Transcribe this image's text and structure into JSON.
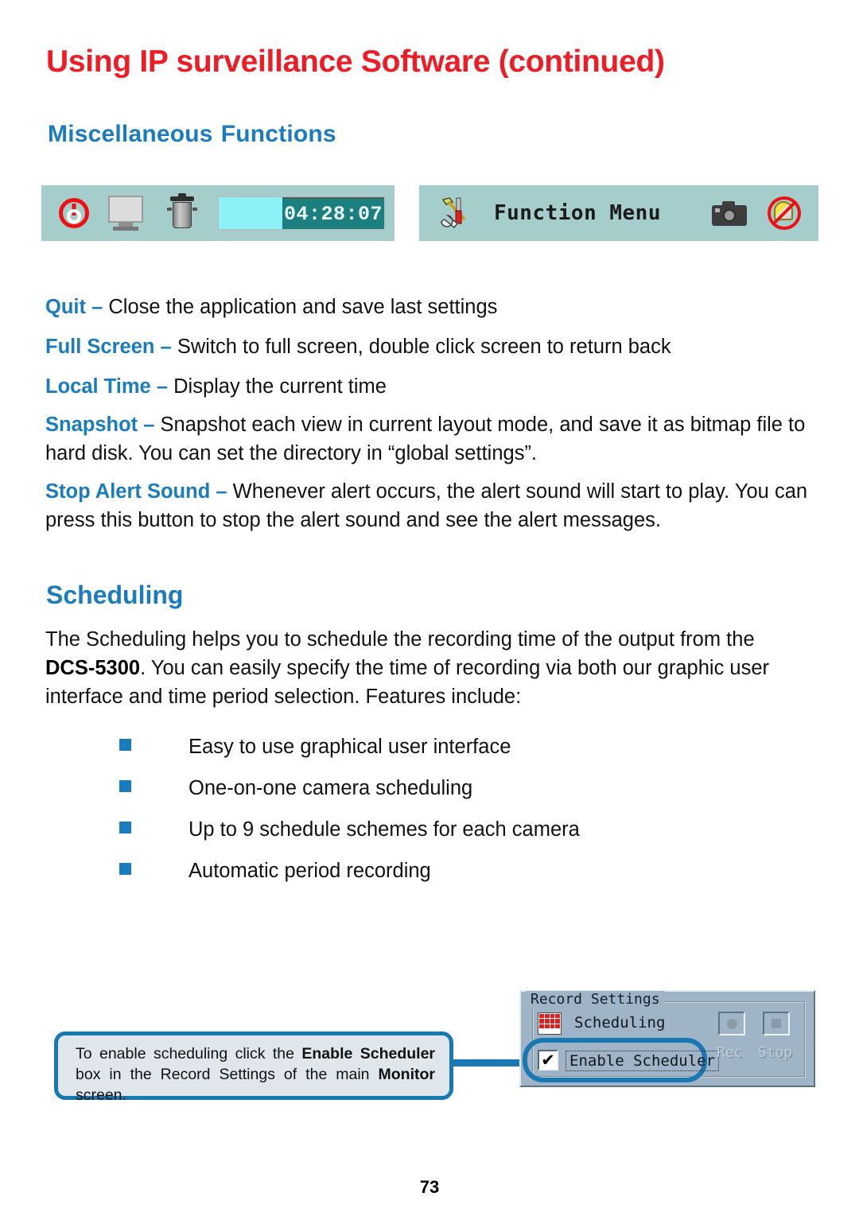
{
  "heading": {
    "title": "Using IP surveillance Software (continued)",
    "subtitle_part1": "Miscellaneous",
    "subtitle_part2": "Functions",
    "title_color": "#ee1c25",
    "accent_color": "#1a7cbe"
  },
  "toolbar_left": {
    "background": "#a5cdcb",
    "power_icon": "power-icon",
    "fullscreen_icon": "monitor-icon",
    "trash_icon": "trash-icon",
    "clock_value": "04:28:07",
    "clock_pad_color": "#8cf2f7",
    "clock_display_color": "#1b7f80"
  },
  "toolbar_right": {
    "background": "#a5cdcb",
    "tools_icon": "tools-icon",
    "label": "Function Menu",
    "snapshot_icon": "camera-icon",
    "stop_alert_icon": "no-sound-icon"
  },
  "definitions": [
    {
      "term": "Quit",
      "dash": " – ",
      "text": "Close the application and save last settings"
    },
    {
      "term": "Full Screen",
      "dash": " – ",
      "text": "Switch to full screen, double click screen to return back"
    },
    {
      "term": "Local Time",
      "dash": " – ",
      "text": "Display the current time"
    },
    {
      "term": "Snapshot",
      "dash": " – ",
      "text": "Snapshot each view in current layout mode, and save it as bitmap file to hard disk. You can set the directory in “global settings”."
    },
    {
      "term": "Stop Alert Sound",
      "dash": " – ",
      "text": "Whenever alert occurs, the alert sound will start to play. You can press this button to stop the alert sound and see the alert messages."
    }
  ],
  "scheduling": {
    "heading": "Scheduling",
    "intro_a": "The Scheduling helps you to schedule the recording time of the output from the ",
    "intro_model": "DCS-5300",
    "intro_b": ". You can easily specify the time of recording via both our graphic user interface and time period selection. Features include:",
    "features": [
      "Easy to use graphical user interface",
      "One-on-one camera scheduling",
      "Up to 9 schedule schemes for each camera",
      "Automatic period recording"
    ],
    "bullet_color": "#1a7cbe"
  },
  "callout": {
    "text_a": "To enable scheduling click the ",
    "bold_1": "Enable Scheduler",
    "text_b": " box in the Record Settings of the main ",
    "bold_2": "Monitor",
    "text_c": " screen.",
    "border_color": "#1878b4",
    "background": "#dfe6ec"
  },
  "record_settings": {
    "group_title": "Record Settings",
    "calendar_icon": "calendar-icon",
    "scheduling_label": "Scheduling",
    "enable_scheduler_label": "Enable Scheduler",
    "enable_scheduler_checked": "✔",
    "rec_button_label": "Rec",
    "stop_button_label": "Stop",
    "panel_background": "#9fb4c7",
    "highlight_color": "#1878b4"
  },
  "footer": {
    "page_number": "73"
  }
}
